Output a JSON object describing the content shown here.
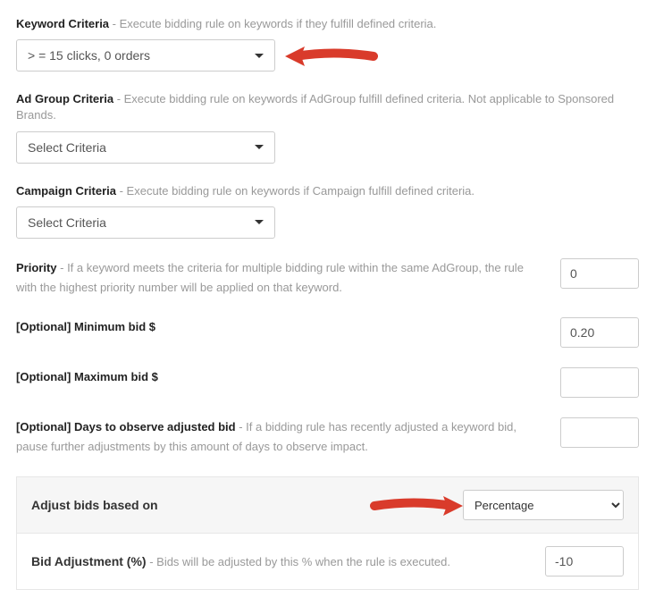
{
  "keyword": {
    "label": "Keyword Criteria",
    "desc": " - Execute bidding rule on keywords if they fulfill defined criteria.",
    "value": "> = 15 clicks, 0 orders"
  },
  "adgroup": {
    "label": "Ad Group Criteria",
    "desc": " - Execute bidding rule on keywords if AdGroup fulfill defined criteria. Not applicable to Sponsored Brands.",
    "value": "Select Criteria"
  },
  "campaign": {
    "label": "Campaign Criteria",
    "desc": " - Execute bidding rule on keywords if Campaign fulfill defined criteria.",
    "value": "Select Criteria"
  },
  "priority": {
    "label": "Priority",
    "desc": " - If a keyword meets the criteria for multiple bidding rule within the same AdGroup, the rule with the highest priority number will be applied on that keyword.",
    "value": "0"
  },
  "minbid": {
    "label": "[Optional] Minimum bid $",
    "value": "0.20"
  },
  "maxbid": {
    "label": "[Optional] Maximum bid $",
    "value": ""
  },
  "observe": {
    "label": "[Optional] Days to observe adjusted bid",
    "desc": " - If a bidding rule has recently adjusted a keyword bid, pause further adjustments by this amount of days to observe impact.",
    "value": ""
  },
  "adjust_based": {
    "label": "Adjust bids based on",
    "value": "Percentage"
  },
  "bid_adj": {
    "label": "Bid Adjustment (%)",
    "desc": " - Bids will be adjusted by this % when the rule is executed.",
    "value": "-10"
  }
}
